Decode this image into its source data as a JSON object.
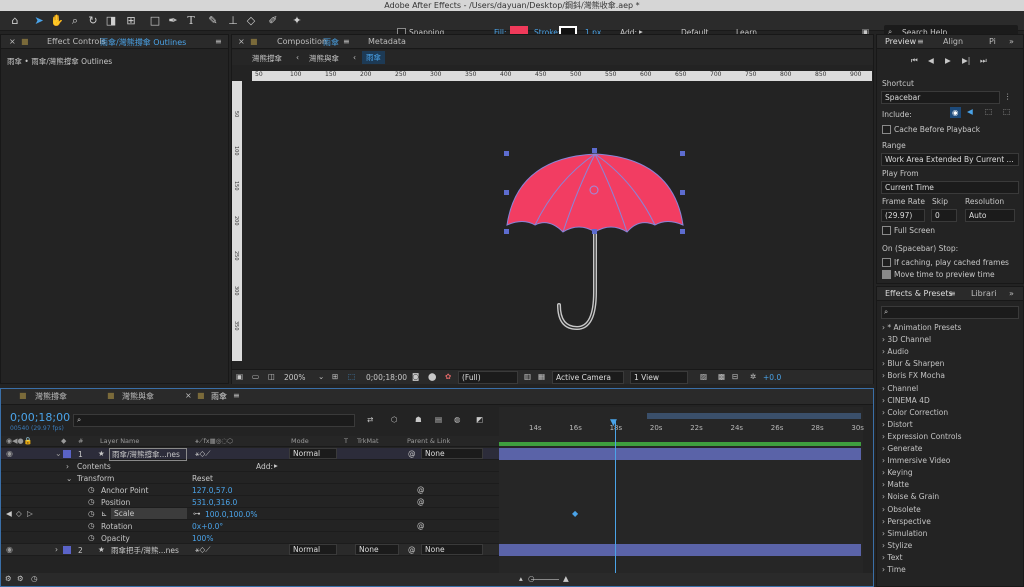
{
  "window_title": "Adobe After Effects - /Users/dayuan/Desktop/鋼鈄/灣熊收傘.aep *",
  "toolbar": {
    "snapping": "Snapping",
    "fill": "Fill:",
    "stroke": "Stroke:",
    "stroke_width": "1 px",
    "add": "Add:",
    "workspace_default": "Default",
    "workspace_learn": "Learn",
    "search_help": "Search Help"
  },
  "effect_controls": {
    "tab_prefix": "Effect Controls",
    "tab_layer": "雨傘/灣熊撐傘 Outlines",
    "header": "雨傘 • 雨傘/灣熊撐傘 Outlines"
  },
  "composition": {
    "tab_prefix": "Composition",
    "tab_name": "雨傘",
    "metadata_tab": "Metadata",
    "breadcrumbs": [
      "灣熊撐傘",
      "灣熊與傘",
      "雨傘"
    ],
    "ruler_ticks": [
      "50",
      "100",
      "150",
      "200",
      "250",
      "300",
      "350",
      "400",
      "450",
      "500",
      "550",
      "600",
      "650",
      "700",
      "750",
      "800",
      "850",
      "900"
    ],
    "vruler_ticks": [
      "50",
      "100",
      "150",
      "200",
      "250",
      "300",
      "350",
      "400",
      "450",
      "500"
    ],
    "zoom": "200%",
    "timecode": "0;00;18;00",
    "resolution": "(Full)",
    "camera": "Active Camera",
    "view": "1 View",
    "exposure": "+0.0"
  },
  "preview": {
    "tab": "Preview",
    "align_tab": "Align",
    "para_tab": "Pi",
    "shortcut_label": "Shortcut",
    "shortcut_value": "Spacebar",
    "include_label": "Include:",
    "cache_label": "Cache Before Playback",
    "range_label": "Range",
    "range_value": "Work Area Extended By Current ...",
    "play_from_label": "Play From",
    "play_from_value": "Current Time",
    "frame_rate_label": "Frame Rate",
    "skip_label": "Skip",
    "resolution_label": "Resolution",
    "frame_rate_value": "(29.97)",
    "skip_value": "0",
    "resolution_value": "Auto",
    "full_screen": "Full Screen",
    "on_stop_label": "On (Spacebar) Stop:",
    "if_caching": "If caching, play cached frames",
    "move_time": "Move time to preview time"
  },
  "effects": {
    "tab": "Effects & Presets",
    "libraries_tab": "Librari",
    "items": [
      "* Animation Presets",
      "3D Channel",
      "Audio",
      "Blur & Sharpen",
      "Boris FX Mocha",
      "Channel",
      "CINEMA 4D",
      "Color Correction",
      "Distort",
      "Expression Controls",
      "Generate",
      "Immersive Video",
      "Keying",
      "Matte",
      "Noise & Grain",
      "Obsolete",
      "Perspective",
      "Simulation",
      "Stylize",
      "Text",
      "Time"
    ]
  },
  "timeline": {
    "tabs": [
      "灣熊撐傘",
      "灣熊與傘",
      "雨傘"
    ],
    "timecode": "0;00;18;00",
    "frame_info": "00540 (29.97 fps)",
    "col_num": "#",
    "col_layer": "Layer Name",
    "col_mode": "Mode",
    "col_t": "T",
    "col_trkmat": "TrkMat",
    "col_parent": "Parent & Link",
    "ticks": [
      "14s",
      "16s",
      "18s",
      "20s",
      "22s",
      "24s",
      "26s",
      "28s",
      "30s"
    ],
    "layer1": {
      "num": "1",
      "name": "雨傘/灣熊撐傘...nes",
      "mode": "Normal",
      "parent": "None"
    },
    "contents": "Contents",
    "add": "Add:",
    "transform": "Transform",
    "reset": "Reset",
    "props": [
      {
        "name": "Anchor Point",
        "value": "127.0,57.0"
      },
      {
        "name": "Position",
        "value": "531.0,316.0"
      },
      {
        "name": "Scale",
        "value": "100.0,100.0%"
      },
      {
        "name": "Rotation",
        "value": "0x+0.0°"
      },
      {
        "name": "Opacity",
        "value": "100%"
      }
    ],
    "layer2": {
      "num": "2",
      "name": "雨傘把手/灣熊...nes",
      "mode": "Normal",
      "trkmat": "None",
      "parent": "None"
    }
  },
  "colors": {
    "fill": "#f03a5a",
    "accent": "#4aa3e8",
    "layer_bar": "#5a63a8",
    "umbrella": "#f23d62",
    "umbrella_rib": "#8a85d8",
    "handle": "#c8c8c8"
  }
}
